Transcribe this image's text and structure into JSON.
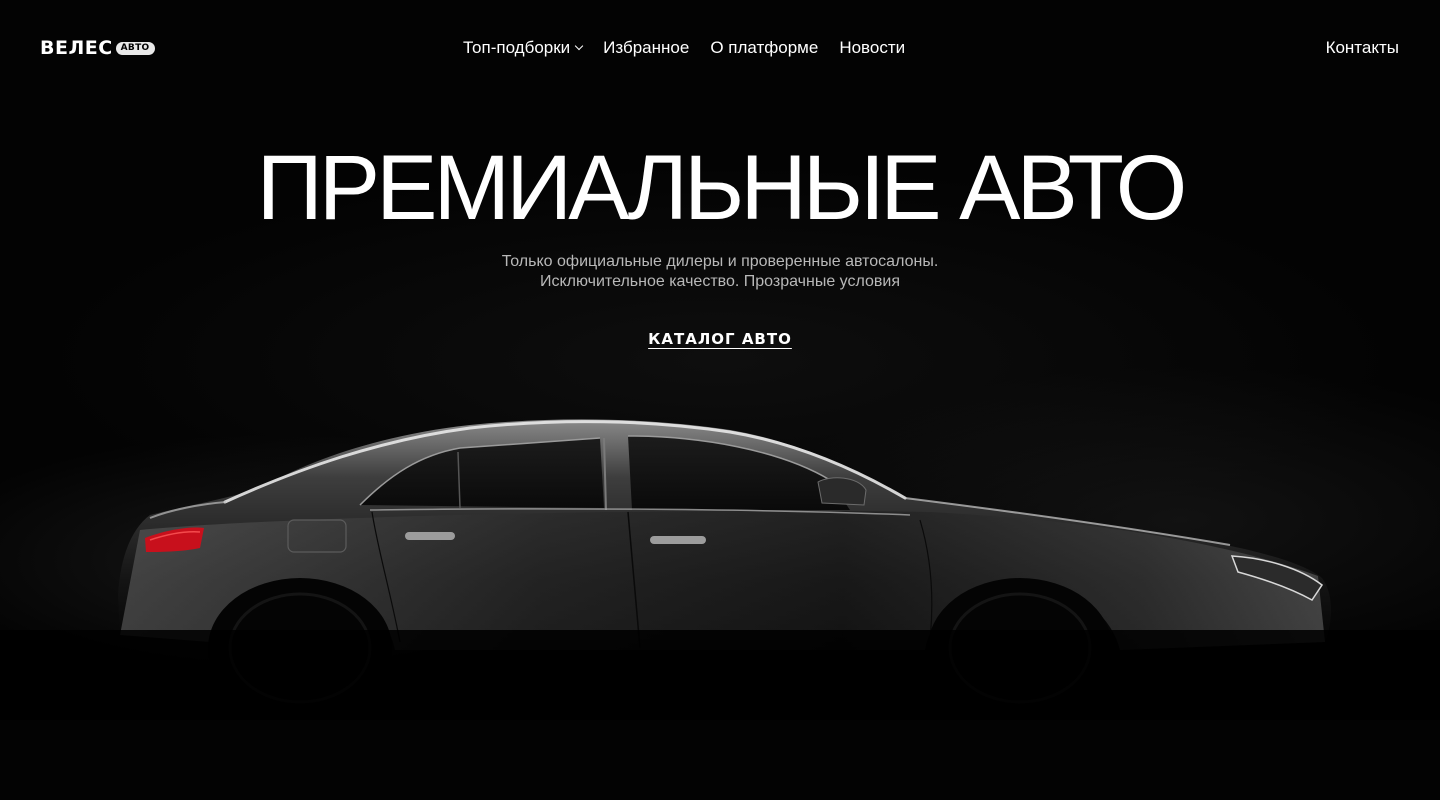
{
  "header": {
    "logo_text": "ВЕЛЕС",
    "logo_badge": "АВТО",
    "nav": [
      {
        "label": "Топ-подборки",
        "has_dropdown": true
      },
      {
        "label": "Избранное"
      },
      {
        "label": "О платформе"
      },
      {
        "label": "Новости"
      }
    ],
    "contacts_label": "Контакты"
  },
  "hero": {
    "title": "ПРЕМИАЛЬНЫЕ АВТО",
    "subtitle_line1": "Только официальные дилеры и проверенные автосалоны.",
    "subtitle_line2": "Исключительное качество. Прозрачные условия",
    "cta_label": "КАТАЛОГ АВТО"
  },
  "colors": {
    "background": "#000000",
    "text": "#ffffff",
    "subtitle": "#b8b8b8",
    "tail_light": "#c8101c"
  },
  "icons": {
    "nav_dropdown": "chevron-down-icon"
  }
}
